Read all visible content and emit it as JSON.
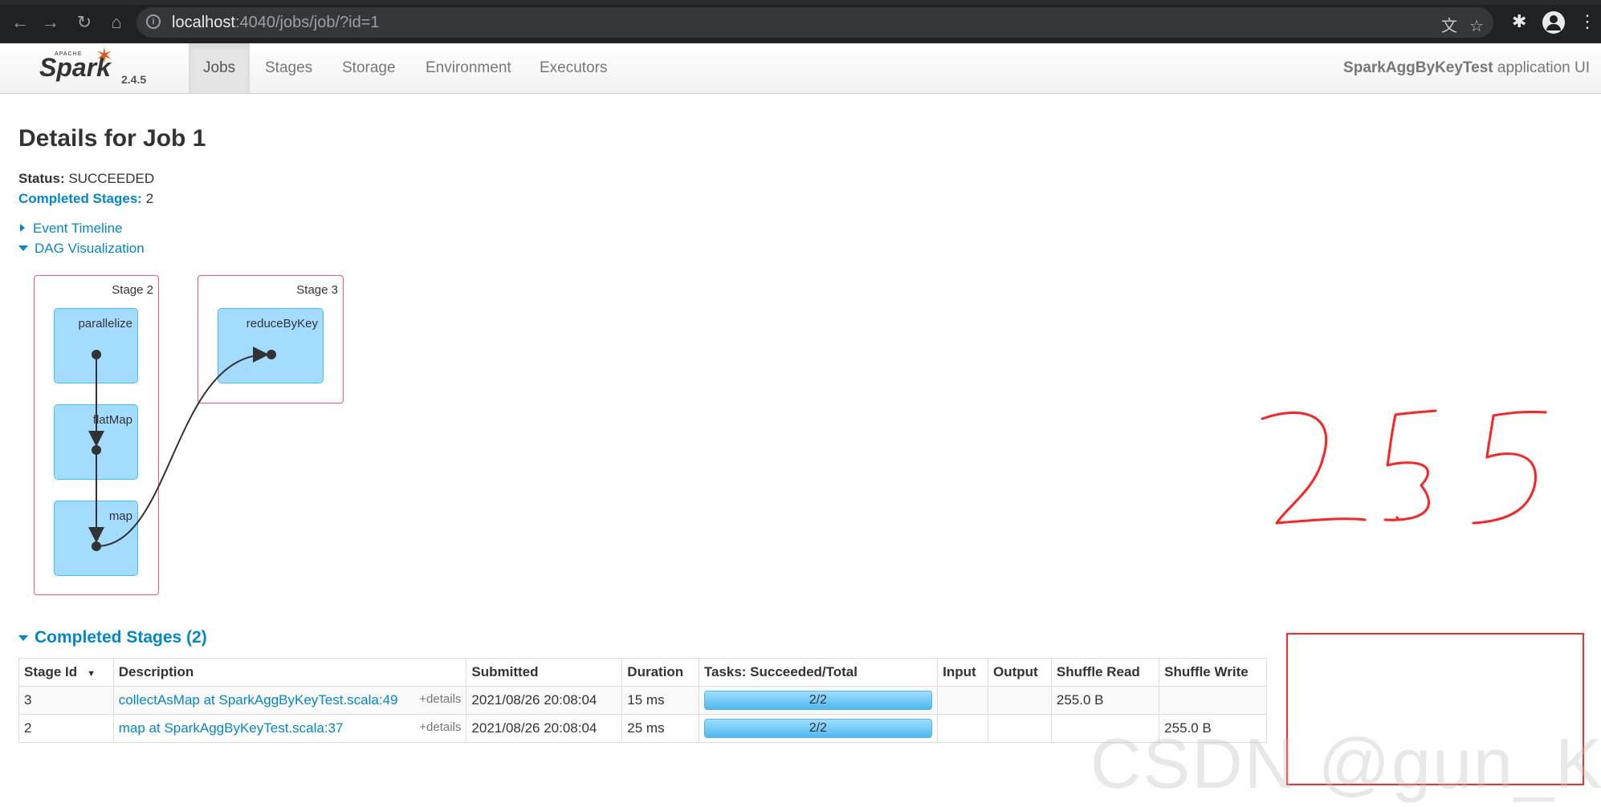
{
  "browser": {
    "url_host": "localhost",
    "url_rest": ":4040/jobs/job/?id=1"
  },
  "navbar": {
    "brand_small": "APACHE",
    "brand": "Spark",
    "version": "2.4.5",
    "tabs": [
      {
        "label": "Jobs",
        "active": true
      },
      {
        "label": "Stages",
        "active": false
      },
      {
        "label": "Storage",
        "active": false
      },
      {
        "label": "Environment",
        "active": false
      },
      {
        "label": "Executors",
        "active": false
      }
    ],
    "app_name": "SparkAggByKeyTest",
    "app_suffix": "application UI"
  },
  "page": {
    "title": "Details for Job 1",
    "status_label": "Status:",
    "status_value": "SUCCEEDED",
    "completed_label": "Completed Stages:",
    "completed_value": "2",
    "event_timeline": "Event Timeline",
    "dag_visualization": "DAG Visualization"
  },
  "dag": {
    "stages": [
      {
        "label": "Stage 2",
        "rdds": [
          "parallelize",
          "flatMap",
          "map"
        ]
      },
      {
        "label": "Stage 3",
        "rdds": [
          "reduceByKey"
        ]
      }
    ]
  },
  "completed_stages": {
    "heading": "Completed Stages (2)",
    "columns": [
      "Stage Id",
      "Description",
      "Submitted",
      "Duration",
      "Tasks: Succeeded/Total",
      "Input",
      "Output",
      "Shuffle Read",
      "Shuffle Write"
    ],
    "rows": [
      {
        "stage_id": "3",
        "description": "collectAsMap at SparkAggByKeyTest.scala:49",
        "details": "+details",
        "submitted": "2021/08/26 20:08:04",
        "duration": "15 ms",
        "tasks": "2/2",
        "input": "",
        "output": "",
        "shuffle_read": "255.0 B",
        "shuffle_write": ""
      },
      {
        "stage_id": "2",
        "description": "map at SparkAggByKeyTest.scala:37",
        "details": "+details",
        "submitted": "2021/08/26 20:08:04",
        "duration": "25 ms",
        "tasks": "2/2",
        "input": "",
        "output": "",
        "shuffle_read": "",
        "shuffle_write": "255.0 B"
      }
    ]
  },
  "annotation": {
    "handwritten": "255",
    "highlight_color": "#ff2a2a"
  },
  "watermark": "CSDN @gun_K",
  "colors": {
    "link": "#0088cc",
    "stage_border": "#ff5475",
    "rdd_fill": "#a4dcff",
    "spark_orange": "#e25a1c"
  }
}
